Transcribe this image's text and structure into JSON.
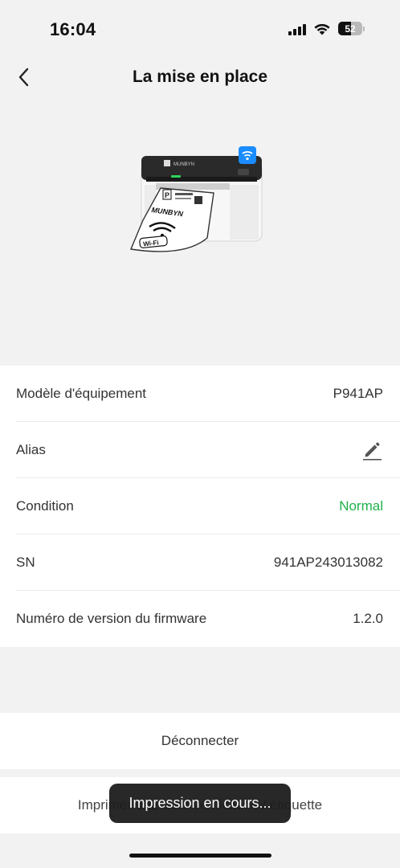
{
  "status_bar": {
    "time": "16:04",
    "battery": "52"
  },
  "header": {
    "title": "La mise en place"
  },
  "hero": {
    "label_brand": "MUNBYN",
    "label_wifi": "Wi-Fi",
    "printer_logo": "MUNBYN"
  },
  "device_info": {
    "rows": [
      {
        "label": "Modèle d'équipement",
        "value": "P941AP"
      },
      {
        "label": "Alias",
        "value": ""
      },
      {
        "label": "Condition",
        "value": "Normal"
      },
      {
        "label": "SN",
        "value": "941AP243013082"
      },
      {
        "label": "Numéro de version du firmware",
        "value": "1.2.0"
      }
    ]
  },
  "actions": {
    "disconnect_label": "Déconnecter",
    "print_label": "Imprimer une auto-vérification / étiquette"
  },
  "toast": {
    "message": "Impression en cours..."
  },
  "colors": {
    "status_ok": "#1fb04b",
    "wifi_badge": "#1a8cff",
    "background": "#f2f2f2"
  },
  "icons": [
    "back-chevron-icon",
    "wifi-badge-icon",
    "edit-pencil-icon",
    "signal-icon",
    "wifi-icon",
    "battery-icon"
  ]
}
